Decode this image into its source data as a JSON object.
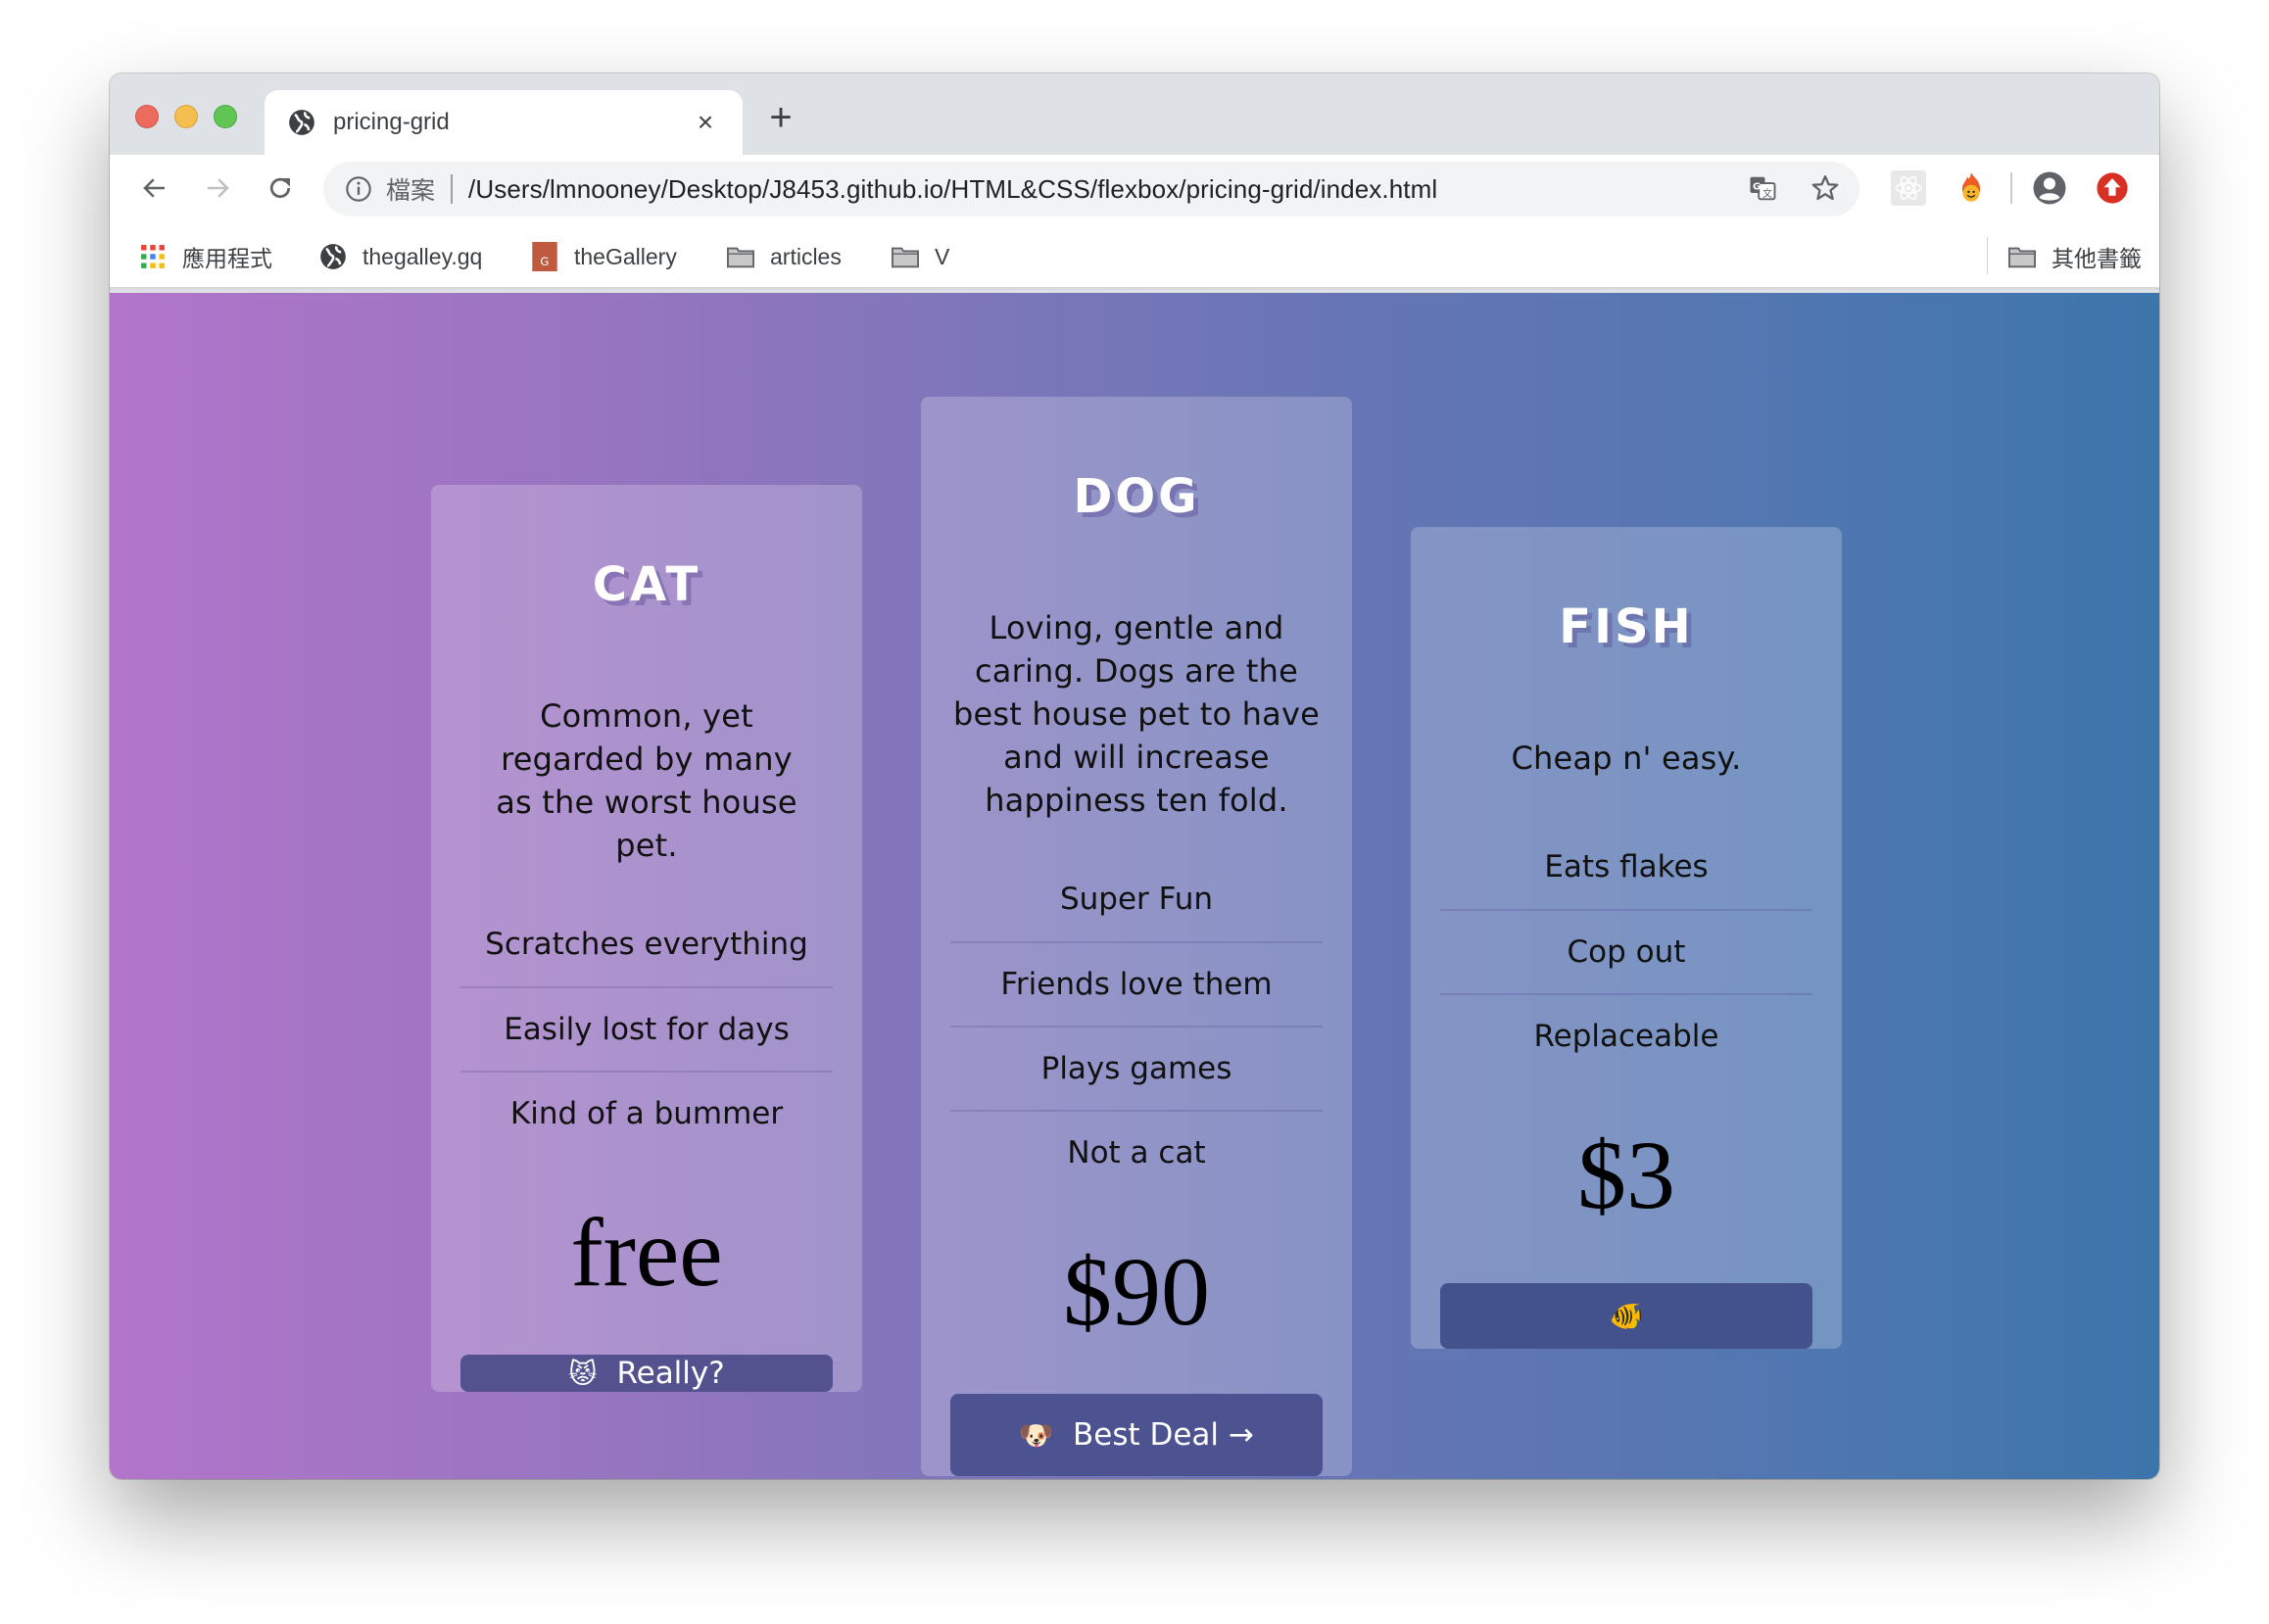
{
  "browser": {
    "tab": {
      "title": "pricing-grid",
      "favicon": "globe-icon",
      "close": "×"
    },
    "new_tab": "+",
    "toolbar": {
      "back": "back-arrow-icon",
      "forward": "forward-arrow-icon",
      "reload": "reload-icon",
      "scheme_label": "檔案",
      "url": "/Users/lmnooney/Desktop/J8453.github.io/HTML&CSS/flexbox/pricing-grid/index.html",
      "actions": [
        "translate-icon",
        "star-icon"
      ],
      "extensions": [
        "react-devtools-icon",
        "hola-fire-icon",
        "profile-icon",
        "update-icon"
      ]
    },
    "bookmarks": [
      {
        "label": "應用程式",
        "icon": "apps-grid-icon"
      },
      {
        "label": "thegalley.gq",
        "icon": "globe-icon"
      },
      {
        "label": "theGallery",
        "icon": "gallery-favicon-icon"
      },
      {
        "label": "articles",
        "icon": "folder-icon"
      },
      {
        "label": "V",
        "icon": "folder-icon"
      }
    ],
    "other_bookmarks": {
      "label": "其他書籤",
      "icon": "folder-icon"
    }
  },
  "colors": {
    "gradient_start": "#b275cb",
    "gradient_end": "#3c75ab",
    "button": "#53528f",
    "heading": "#ffffff"
  },
  "cards": [
    {
      "name": "CAT",
      "description": "Common, yet regarded by many as the worst house pet.",
      "features": [
        "Scratches everything",
        "Easily lost for days",
        "Kind of a bummer"
      ],
      "price": "free",
      "button": {
        "emoji": "😾",
        "label": "Really?"
      }
    },
    {
      "name": "DOG",
      "description": "Loving, gentle and caring. Dogs are the best house pet to have and will increase happiness ten fold.",
      "features": [
        "Super Fun",
        "Friends love them",
        "Plays games",
        "Not a cat"
      ],
      "price": "$90",
      "button": {
        "emoji": "🐶",
        "label": "Best Deal →"
      }
    },
    {
      "name": "FISH",
      "description": "Cheap n' easy.",
      "features": [
        "Eats flakes",
        "Cop out",
        "Replaceable"
      ],
      "price": "$3",
      "button": {
        "emoji": "🐠",
        "label": ""
      }
    }
  ]
}
